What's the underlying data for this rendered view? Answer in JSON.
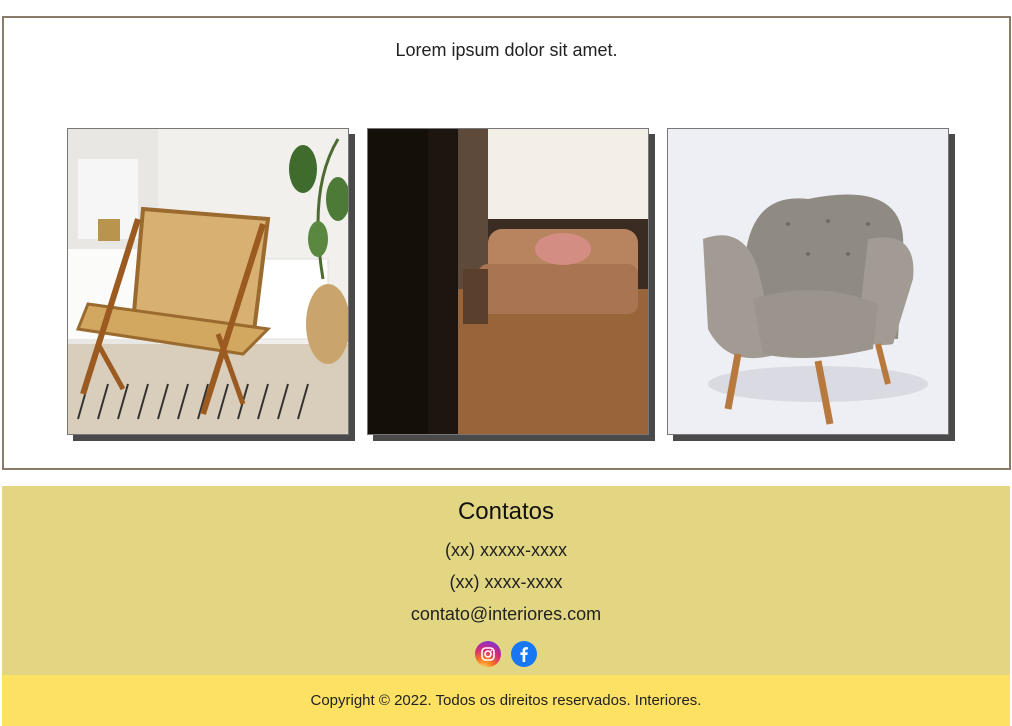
{
  "gallery": {
    "intro_text": "Lorem ipsum dolor sit amet.",
    "images": [
      {
        "name": "rattan-chair-photo"
      },
      {
        "name": "leather-sofa-photo"
      },
      {
        "name": "grey-armchair-photo"
      }
    ]
  },
  "contacts": {
    "title": "Contatos",
    "phone_mobile": "(xx) xxxxx-xxxx",
    "phone_landline": "(xx) xxxx-xxxx",
    "email": "contato@interiores.com",
    "social": [
      {
        "icon": "instagram-icon",
        "color": "#d62976"
      },
      {
        "icon": "facebook-icon",
        "color": "#1877f2"
      }
    ]
  },
  "footer": {
    "copyright": "Copyright © 2022. Todos os direitos reservados. Interiores."
  },
  "colors": {
    "contacts_bg": "#e2d682",
    "footer_bg": "#fde163",
    "frame_border": "#8a7a68"
  }
}
